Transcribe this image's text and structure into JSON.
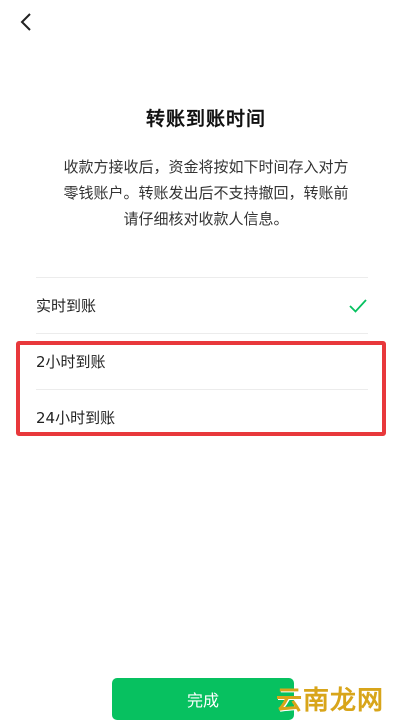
{
  "header": {
    "back_icon": "chevron-left-icon"
  },
  "title": "转账到账时间",
  "description": {
    "line1": "收款方接收后，资金将按如下时间存入对方",
    "line2": "零钱账户。转账发出后不支持撤回，转账前",
    "line3": "请仔细核对收款人信息。"
  },
  "options": [
    {
      "label": "实时到账",
      "selected": true
    },
    {
      "label": "2小时到账",
      "selected": false
    },
    {
      "label": "24小时到账",
      "selected": false
    }
  ],
  "done_label": "完成",
  "watermark": "云南龙网",
  "colors": {
    "accent": "#07c160",
    "highlight": "#e8383b",
    "watermark": "#d8a51a"
  }
}
